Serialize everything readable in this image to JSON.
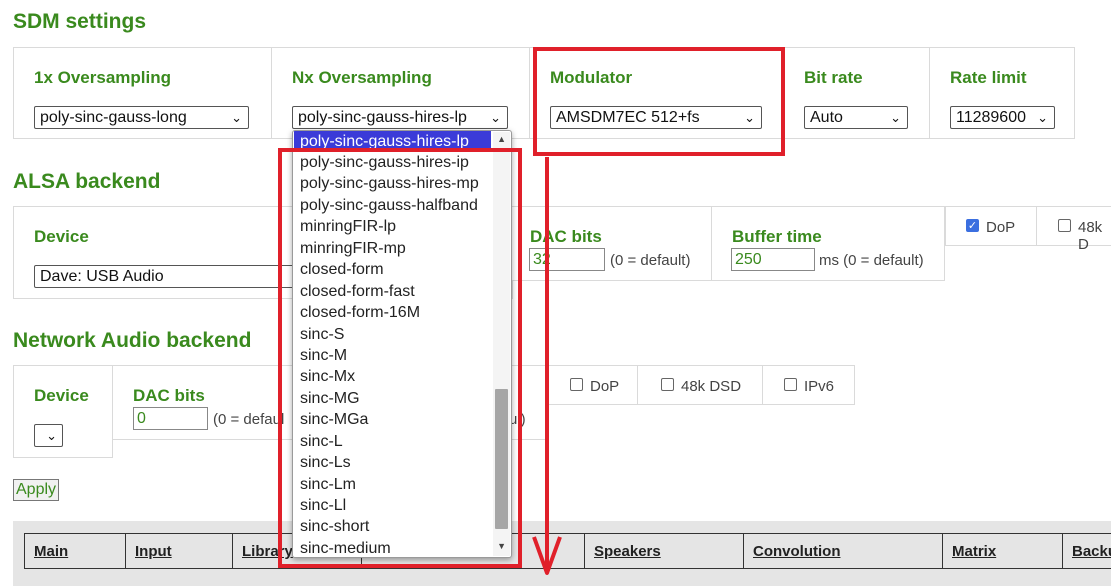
{
  "sdm": {
    "title": "SDM settings",
    "oversampling_1x": {
      "label": "1x Oversampling",
      "value": "poly-sinc-gauss-long"
    },
    "oversampling_nx": {
      "label": "Nx Oversampling",
      "value": "poly-sinc-gauss-hires-lp"
    },
    "modulator": {
      "label": "Modulator",
      "value": "AMSDM7EC 512+fs"
    },
    "bit_rate": {
      "label": "Bit rate",
      "value": "Auto"
    },
    "rate_limit": {
      "label": "Rate limit",
      "value": "11289600"
    }
  },
  "alsa": {
    "title": "ALSA backend",
    "device_label": "Device",
    "device_value": "Dave: USB Audio",
    "dac_bits_label": "DAC bits",
    "dac_bits_value": "32",
    "dac_bits_hint": "(0 = default)",
    "buffer_label": "Buffer time",
    "buffer_value": "250",
    "buffer_hint": "ms (0 = default)",
    "dop_label": "DoP",
    "dop_checked": true,
    "dsd48k_label": "48k D"
  },
  "network": {
    "title": "Network Audio backend",
    "device_label": "Device",
    "device_value": "",
    "dac_bits_label": "DAC bits",
    "dac_bits_value": "0",
    "dac_bits_hint": "(0 = defaul",
    "hidden_hint": "ul)",
    "dop_label": "DoP",
    "dsd48k_label": "48k DSD",
    "ipv6_label": "IPv6"
  },
  "apply_label": "Apply",
  "nav": {
    "main": "Main",
    "input": "Input",
    "library": "Library",
    "speakers": "Speakers",
    "convolution": "Convolution",
    "matrix": "Matrix",
    "backup": "Backu"
  },
  "dropdown": {
    "highlighted": "poly-sinc-gauss-hires-lp",
    "options": [
      "poly-sinc-gauss-hires-lp",
      "poly-sinc-gauss-hires-ip",
      "poly-sinc-gauss-hires-mp",
      "poly-sinc-gauss-halfband",
      "minringFIR-lp",
      "minringFIR-mp",
      "closed-form",
      "closed-form-fast",
      "closed-form-16M",
      "sinc-S",
      "sinc-M",
      "sinc-Mx",
      "sinc-MG",
      "sinc-MGa",
      "sinc-L",
      "sinc-Ls",
      "sinc-Lm",
      "sinc-Ll",
      "sinc-short",
      "sinc-medium"
    ]
  },
  "colors": {
    "accent_green": "#3a8a1e",
    "annotation_red": "#e0202a",
    "highlight_blue": "#3b3bd8"
  }
}
